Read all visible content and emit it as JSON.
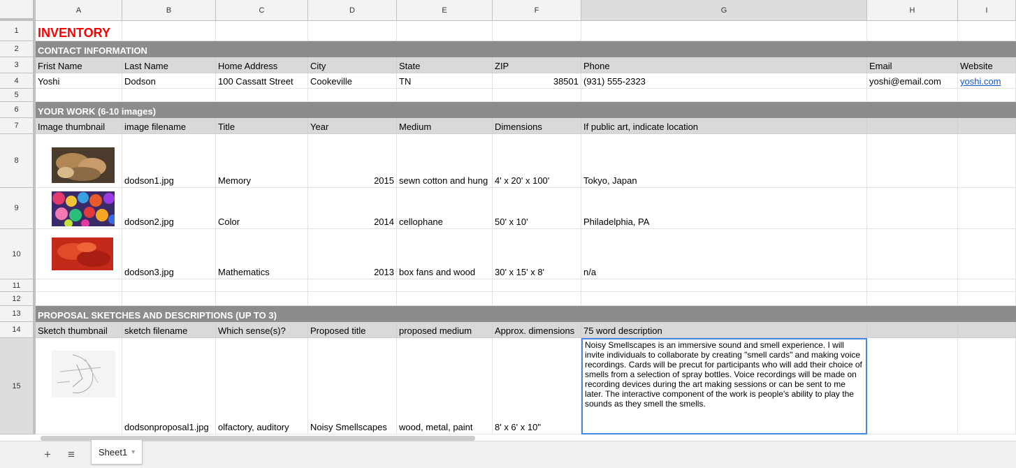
{
  "columns": [
    "A",
    "B",
    "C",
    "D",
    "E",
    "F",
    "G",
    "H",
    "I"
  ],
  "rows": [
    "1",
    "2",
    "3",
    "4",
    "5",
    "6",
    "7",
    "8",
    "9",
    "10",
    "11",
    "12",
    "13",
    "14",
    "15"
  ],
  "title": "INVENTORY",
  "sections": {
    "contact": "CONTACT INFORMATION",
    "work": "YOUR WORK (6-10 images)",
    "proposal": "PROPOSAL SKETCHES AND DESCRIPTIONS (UP TO 3)"
  },
  "contact_headers": [
    "Frist Name",
    "Last Name",
    "Home Address",
    "City",
    "State",
    "ZIP",
    "Phone",
    "Email",
    "Website"
  ],
  "contact_values": [
    "Yoshi",
    "Dodson",
    "100 Cassatt Street",
    "Cookeville",
    "TN",
    "38501",
    "(931) 555-2323",
    "yoshi@email.com",
    "yoshi.com"
  ],
  "work_headers": [
    "Image thumbnail",
    "image filename",
    "Title",
    "Year",
    "Medium",
    "Dimensions",
    "If public art, indicate location"
  ],
  "works": [
    {
      "thumb": "mushroom-sculpture-thumbnail",
      "filename": "dodson1.jpg",
      "title": "Memory",
      "year": "2015",
      "medium": "sewn cotton and hung",
      "dimensions": "4' x 20' x 100'",
      "location": "Tokyo, Japan"
    },
    {
      "thumb": "colorful-balls-thumbnail",
      "filename": "dodson2.jpg",
      "title": "Color",
      "year": "2014",
      "medium": "cellophane",
      "dimensions": "50' x 10'",
      "location": "Philadelphia, PA"
    },
    {
      "thumb": "red-fabric-thumbnail",
      "filename": "dodson3.jpg",
      "title": "Mathematics",
      "year": "2013",
      "medium": "box fans and wood",
      "dimensions": "30' x 15' x 8'",
      "location": "n/a"
    }
  ],
  "proposal_headers": [
    "Sketch thumbnail",
    "sketch filename",
    "Which sense(s)?",
    "Proposed title",
    "proposed medium",
    "Approx. dimensions",
    "75 word description"
  ],
  "proposal": {
    "filename": "dodsonproposal1.jpg",
    "senses": "olfactory, auditory",
    "title": "Noisy Smellscapes",
    "medium": "wood, metal, paint",
    "dimensions": "8' x 6' x 10\"",
    "description": "Noisy Smellscapes is an immersive sound and smell experience. I will invite individuals to collaborate by creating \"smell cards\" and making voice recordings. Cards will be precut for participants who will add their choice of smells from a selection of spray bottles. Voice recordings will be made on recording devices during the art making sessions or can be sent to me later. The interactive component of the work is people's ability to play the sounds as they smell the smells."
  },
  "tabs": {
    "add_label": "+",
    "list_label": "≡",
    "sheet_name": "Sheet1",
    "sheet_menu": "▾"
  },
  "colors": {
    "title": "#ff0000",
    "section_band": "#8c8c8c",
    "header_band": "#d9d9d9",
    "link": "#1155cc",
    "selection": "#4a86e8"
  }
}
